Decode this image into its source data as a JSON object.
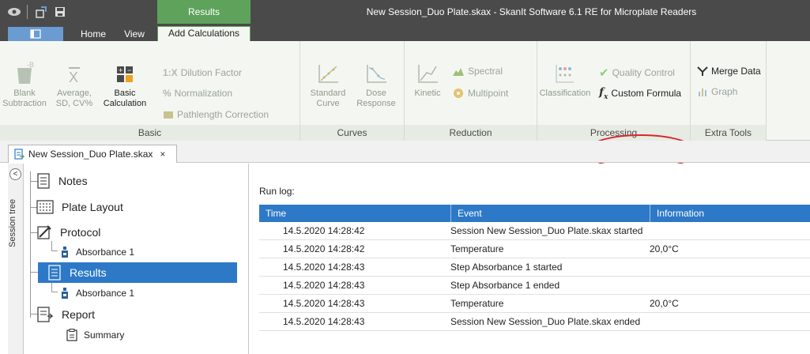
{
  "titlebar": {
    "context_tab": "Results",
    "title": "New Session_Duo Plate.skax - SkanIt Software 6.1 RE for Microplate Readers"
  },
  "tabs": [
    {
      "label": "Home",
      "active": false
    },
    {
      "label": "View",
      "active": false
    },
    {
      "label": "Add Calculations",
      "active": true
    }
  ],
  "ribbon": {
    "basic": {
      "label": "Basic",
      "blank": "Blank Subtraction",
      "average": "Average, SD, CV%",
      "basic_calc": "Basic Calculation",
      "dilution": "Dilution Factor",
      "normalization": "Normalization",
      "pathlength": "Pathlength Correction"
    },
    "curves": {
      "label": "Curves",
      "standard": "Standard Curve",
      "dose": "Dose Response"
    },
    "reduction": {
      "label": "Reduction",
      "kinetic": "Kinetic",
      "spectral": "Spectral",
      "multipoint": "Multipoint"
    },
    "processing": {
      "label": "Processing",
      "classification": "Classification",
      "quality": "Quality Control",
      "custom_formula": "Custom Formula"
    },
    "extra": {
      "label": "Extra Tools",
      "merge": "Merge Data",
      "graph": "Graph"
    }
  },
  "document_tab": {
    "label": "New Session_Duo Plate.skax",
    "close": "×"
  },
  "session_tree": {
    "strip_label": "Session tree",
    "collapse": "<",
    "items": [
      {
        "label": "Notes"
      },
      {
        "label": "Plate Layout"
      },
      {
        "label": "Protocol"
      },
      {
        "label": "Absorbance 1"
      },
      {
        "label": "Results"
      },
      {
        "label": "Absorbance 1"
      },
      {
        "label": "Report"
      },
      {
        "label": "Summary"
      }
    ]
  },
  "run_log": {
    "label": "Run log:",
    "columns": [
      "Time",
      "Event",
      "Information"
    ],
    "rows": [
      {
        "time": "14.5.2020 14:28:42",
        "event": "Session New Session_Duo Plate.skax started",
        "info": ""
      },
      {
        "time": "14.5.2020 14:28:42",
        "event": "Temperature",
        "info": "20,0°C"
      },
      {
        "time": "14.5.2020 14:28:43",
        "event": "Step Absorbance 1 started",
        "info": ""
      },
      {
        "time": "14.5.2020 14:28:43",
        "event": "Step Absorbance 1 ended",
        "info": ""
      },
      {
        "time": "14.5.2020 14:28:43",
        "event": "Temperature",
        "info": "20,0°C"
      },
      {
        "time": "14.5.2020 14:28:43",
        "event": "Session New Session_Duo Plate.skax ended",
        "info": ""
      }
    ]
  },
  "colors": {
    "accent_green": "#5ea25b",
    "selection_blue": "#2d79c7",
    "highlight_red": "#d9262c"
  }
}
